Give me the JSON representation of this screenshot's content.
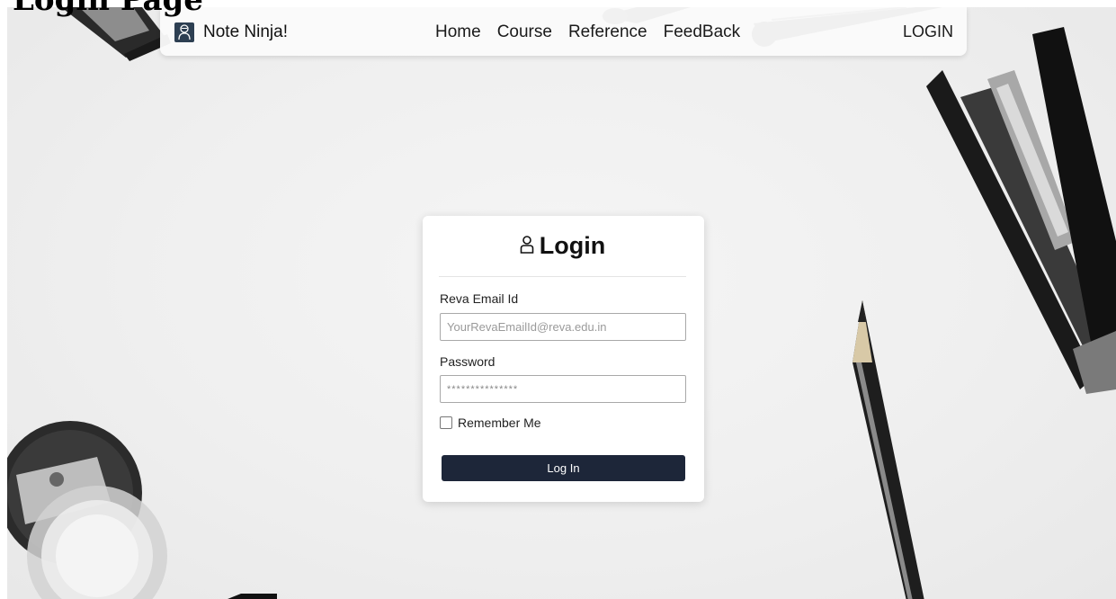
{
  "page_heading": "Login Page",
  "navbar": {
    "brand": "Note Ninja!",
    "links": [
      "Home",
      "Course",
      "Reference",
      "FeedBack"
    ],
    "login": "LOGIN"
  },
  "login_card": {
    "title": "Login",
    "icon": "user-icon",
    "email_label": "Reva Email Id",
    "email_placeholder": "YourRevaEmailId@reva.edu.in",
    "password_label": "Password",
    "password_value": "***************",
    "remember_label": "Remember Me",
    "remember_checked": false,
    "submit_label": "Log In"
  },
  "colors": {
    "navbar_bg": "#fafafa",
    "brand_logo": "#2d3f52",
    "button_bg": "#1d2639",
    "page_bg": "#efefef"
  }
}
